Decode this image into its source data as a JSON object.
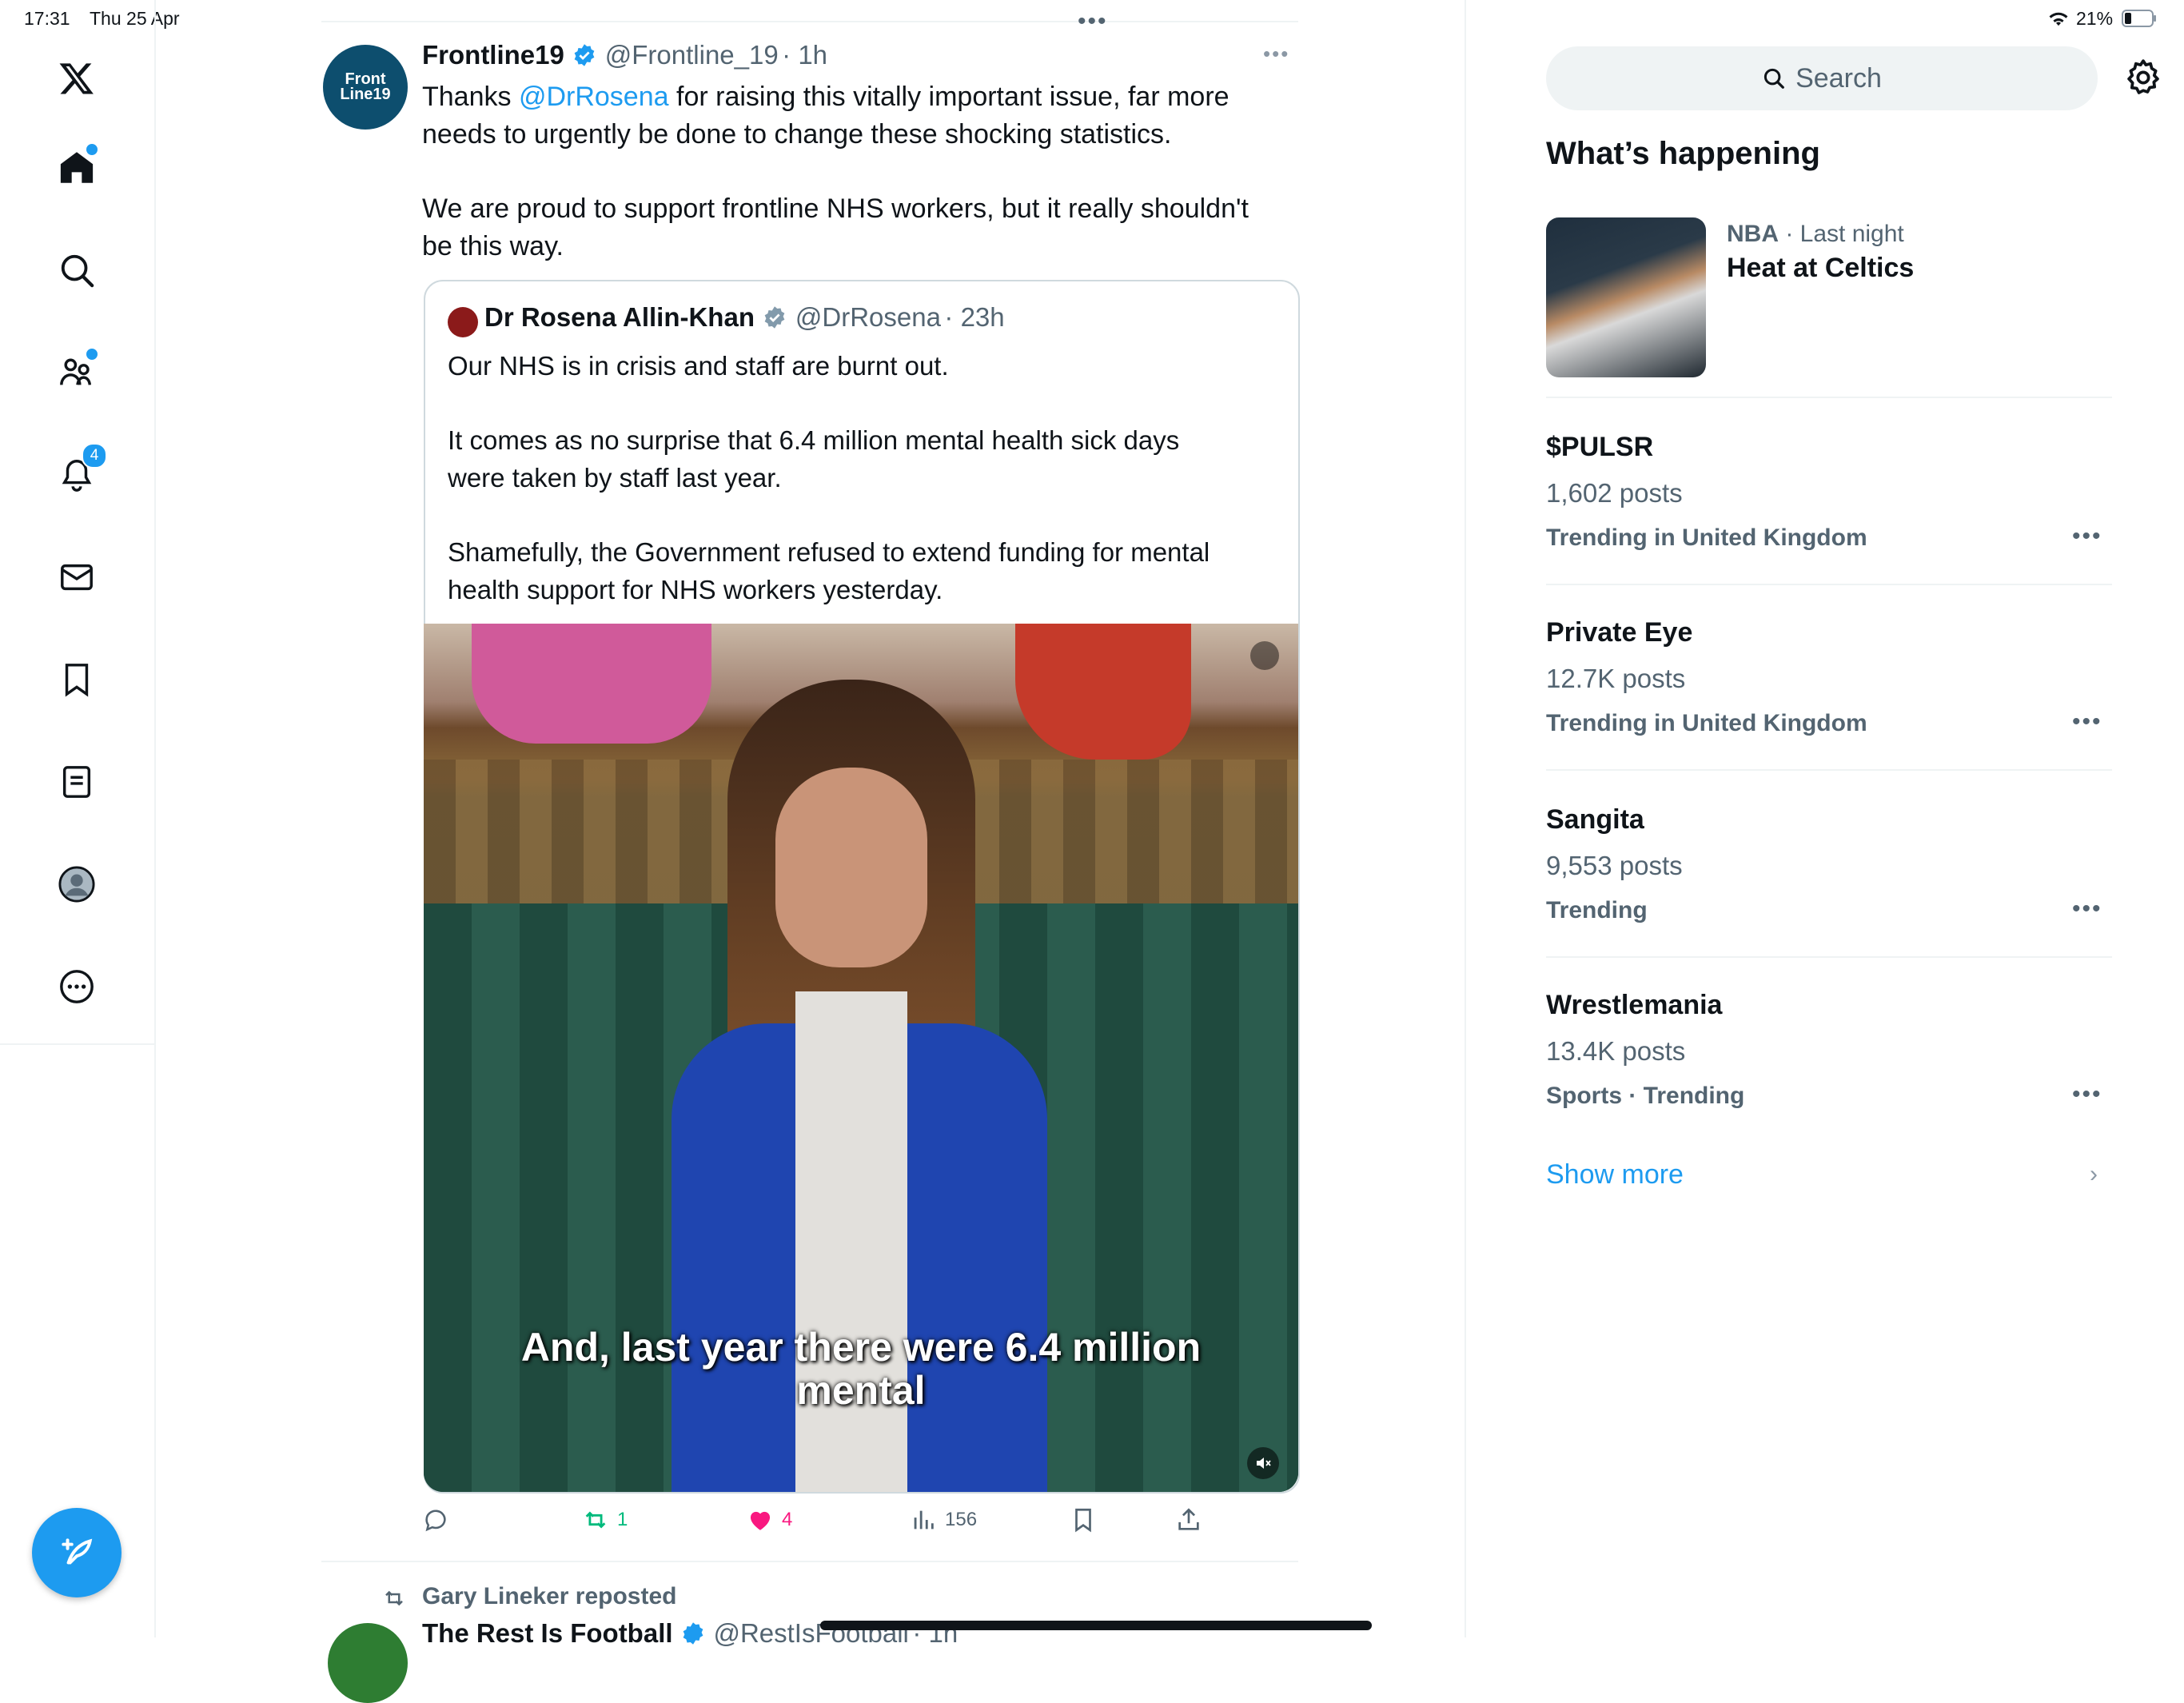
{
  "status_bar": {
    "time": "17:31",
    "date": "Thu 25 Apr",
    "battery": "21%"
  },
  "nav": {
    "notifications_badge": "4",
    "items": [
      "X logo",
      "Home",
      "Explore",
      "Communities",
      "Notifications",
      "Messages",
      "Bookmarks",
      "Lists",
      "Profile",
      "More"
    ]
  },
  "tweet": {
    "avatar_text": "Front Line19",
    "name": "Frontline19",
    "handle": "@Frontline_19",
    "time": "· 1h",
    "text_pre": "Thanks ",
    "mention": "@DrRosena",
    "text_post": " for raising this vitally important issue, far more",
    "text_line2": "needs to urgently be done to change these shocking statistics.",
    "text_p2_l1": "We are proud to support frontline NHS workers, but it really shouldn't",
    "text_p2_l2": "be this way.",
    "quote": {
      "name": "Dr Rosena Allin-Khan",
      "handle": "@DrRosena",
      "time": "· 23h",
      "line1": "Our NHS is in crisis and staff are burnt out.",
      "line2": "It comes as no surprise that 6.4 million mental health sick days",
      "line3": "were taken by staff last year.",
      "line4": "Shamefully, the Government refused to extend funding for mental",
      "line5": "health support for NHS workers yesterday.",
      "caption_l1": "And, last year there were 6.4 million",
      "caption_l2": "mental"
    },
    "actions": {
      "retweets": "1",
      "likes": "4",
      "views": "156"
    }
  },
  "next_tweet": {
    "reposted_by": "Gary Lineker reposted",
    "name": "The Rest Is Football",
    "handle": "@RestIsFootball",
    "time": "· 1h"
  },
  "sidebar": {
    "search_placeholder": "Search",
    "heading": "What’s happening",
    "featured": {
      "category": "NBA",
      "time": " · Last night",
      "title": "Heat at Celtics"
    },
    "trends": [
      {
        "title": "$PULSR",
        "count": "1,602 posts",
        "context": "Trending in United Kingdom"
      },
      {
        "title": "Private Eye",
        "count": "12.7K posts",
        "context": "Trending in United Kingdom"
      },
      {
        "title": "Sangita",
        "count": "9,553 posts",
        "context": "Trending"
      },
      {
        "title": "Wrestlemania",
        "count": "13.4K posts",
        "context": "Sports · Trending"
      }
    ],
    "show_more": "Show more"
  },
  "colors": {
    "accent": "#1d9bf0",
    "like": "#f91880",
    "retweet": "#00ba7c",
    "text": "#0f1419",
    "muted": "#536471"
  }
}
